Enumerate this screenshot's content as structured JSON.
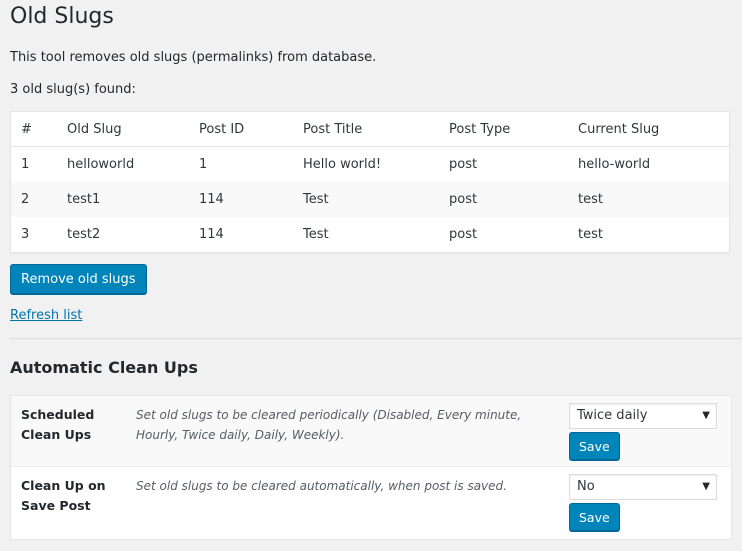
{
  "page": {
    "title": "Old Slugs",
    "intro": "This tool removes old slugs (permalinks) from database.",
    "found": "3 old slug(s) found:"
  },
  "table": {
    "headers": [
      "#",
      "Old Slug",
      "Post ID",
      "Post Title",
      "Post Type",
      "Current Slug"
    ],
    "rows": [
      [
        "1",
        "helloworld",
        "1",
        "Hello world!",
        "post",
        "hello-world"
      ],
      [
        "2",
        "test1",
        "114",
        "Test",
        "post",
        "test"
      ],
      [
        "3",
        "test2",
        "114",
        "Test",
        "post",
        "test"
      ]
    ]
  },
  "actions": {
    "remove_label": "Remove old slugs",
    "refresh_label": "Refresh list"
  },
  "cleanups": {
    "heading": "Automatic Clean Ups",
    "items": [
      {
        "label": "Scheduled Clean Ups",
        "description": "Set old slugs to be cleared periodically (Disabled, Every minute, Hourly, Twice daily, Daily, Weekly).",
        "selected": "Twice daily",
        "save_label": "Save"
      },
      {
        "label": "Clean Up on Save Post",
        "description": "Set old slugs to be cleared automatically, when post is saved.",
        "selected": "No",
        "save_label": "Save"
      }
    ]
  },
  "icons": {
    "dropdown": "chevron-down-icon"
  },
  "colors": {
    "primary": "#0085ba",
    "link": "#0073aa",
    "background": "#f1f1f1"
  }
}
